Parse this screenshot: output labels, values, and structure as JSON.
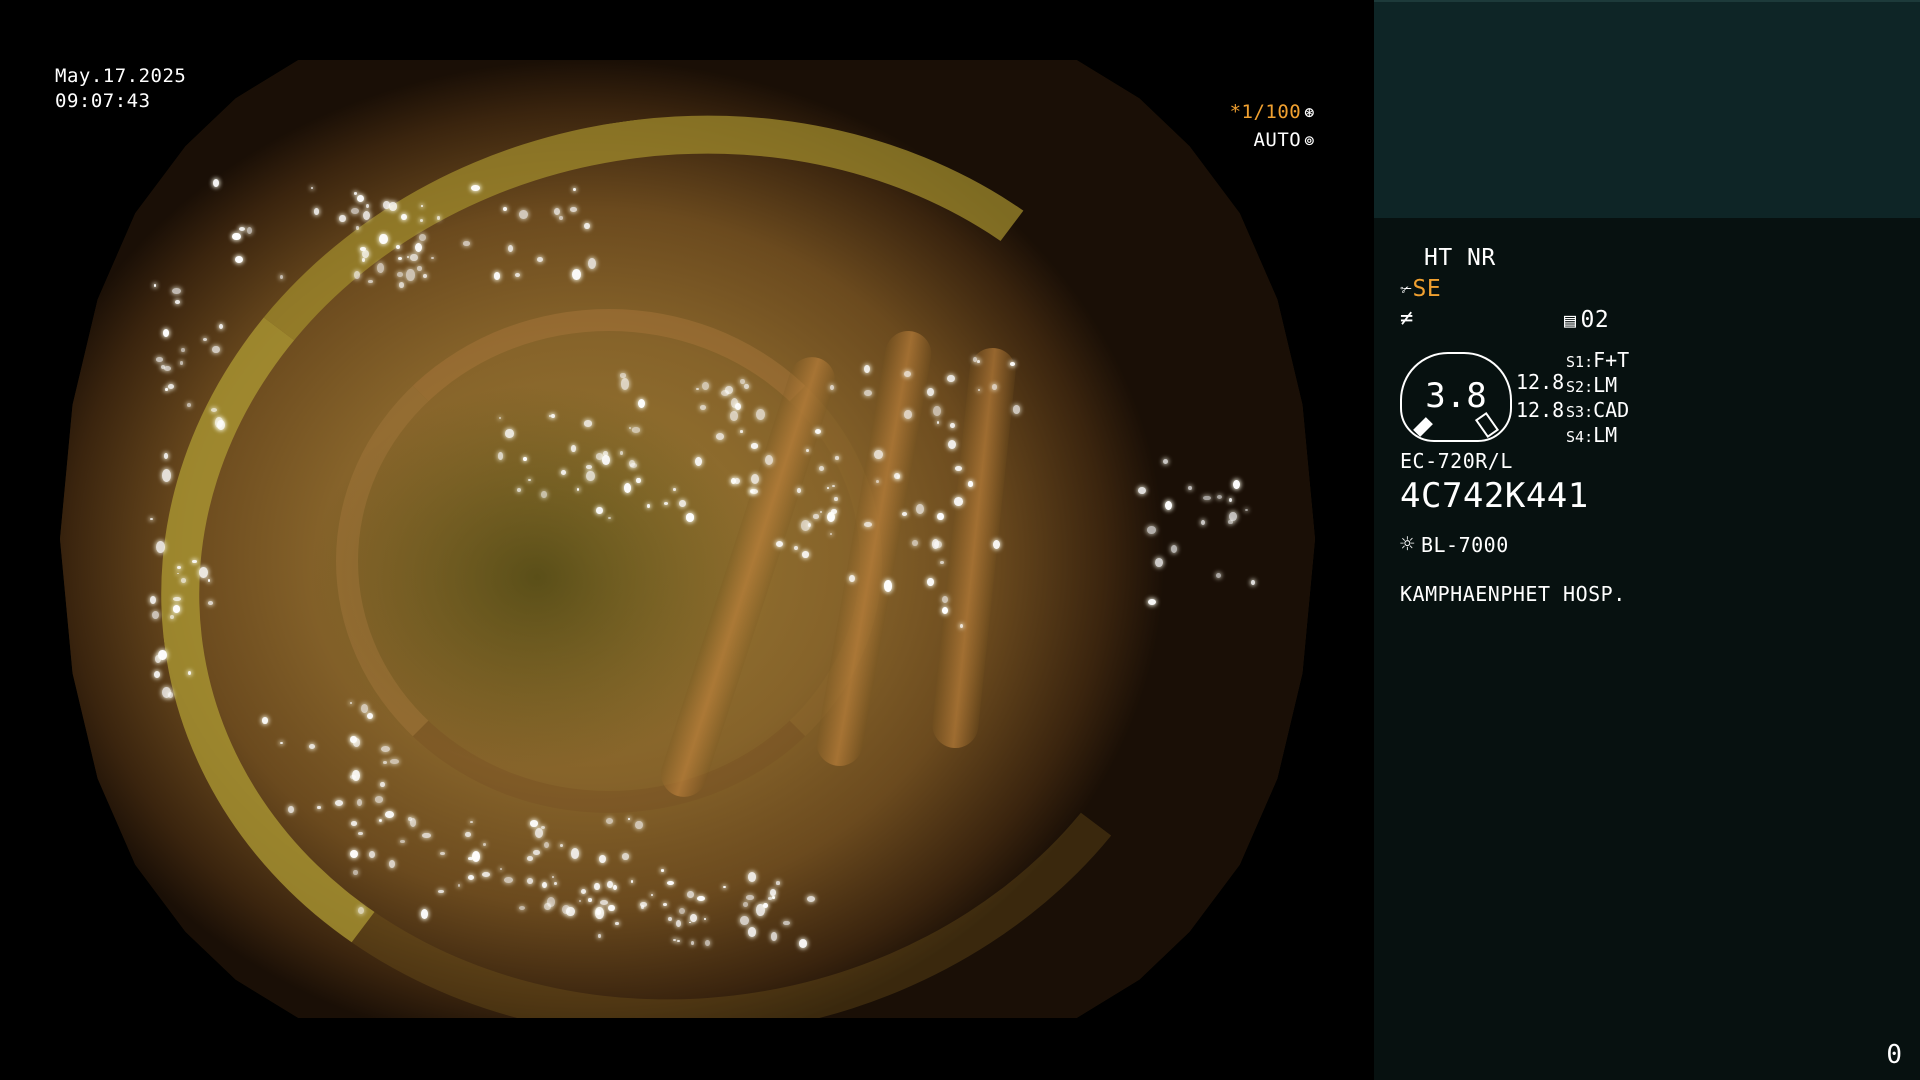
{
  "overlay": {
    "date": "May.17.2025",
    "time": "09:07:43",
    "shutter": "*1/100",
    "shutter_icon": "aperture-icon",
    "auto": "AUTO",
    "auto_icon": "iris-icon"
  },
  "panel": {
    "ht_nr": "HT NR",
    "se_icon": "scissor-icon",
    "se_label": "SE",
    "filter_icon": "not-equal-icon",
    "memory_icon": "memory-icon",
    "memory_value": "02",
    "zoom": "3.8",
    "zoom_values": [
      "12.8",
      "12.8"
    ],
    "switches": [
      {
        "key": "S1",
        "value": "F+T"
      },
      {
        "key": "S2",
        "value": "LM"
      },
      {
        "key": "S3",
        "value": "CAD"
      },
      {
        "key": "S4",
        "value": "LM"
      }
    ],
    "scope_model": "EC-720R/L",
    "scope_serial": "4C742K441",
    "light_icon": "sun-icon",
    "light_source": "BL-7000",
    "hospital": "KAMPHAENPHET HOSP.",
    "counter": "0"
  },
  "colors": {
    "accent_orange": "#f0a030",
    "panel_bg": "#071110",
    "thumb_bg": "#0e2526"
  }
}
